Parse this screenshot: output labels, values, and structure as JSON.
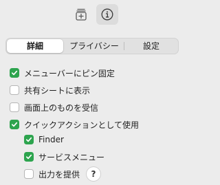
{
  "toolbar": {
    "buttons": [
      {
        "icon": "add-to-stack-icon",
        "selected": false
      },
      {
        "icon": "info-icon",
        "selected": true
      }
    ]
  },
  "tabs": [
    {
      "label": "詳細",
      "selected": true
    },
    {
      "label": "プライバシー",
      "selected": false
    },
    {
      "label": "設定",
      "selected": false
    }
  ],
  "options": [
    {
      "label": "メニューバーにピン固定",
      "checked": true
    },
    {
      "label": "共有シートに表示",
      "checked": false
    },
    {
      "label": "画面上のものを受信",
      "checked": false
    },
    {
      "label": "クイックアクションとして使用",
      "checked": true
    }
  ],
  "quick_actions": [
    {
      "label": "Finder",
      "checked": true
    },
    {
      "label": "サービスメニュー",
      "checked": true
    },
    {
      "label": "出力を提供",
      "checked": false
    }
  ],
  "help_label": "?",
  "colors": {
    "checkbox_on": "#2da44e",
    "background": "#ececec"
  }
}
